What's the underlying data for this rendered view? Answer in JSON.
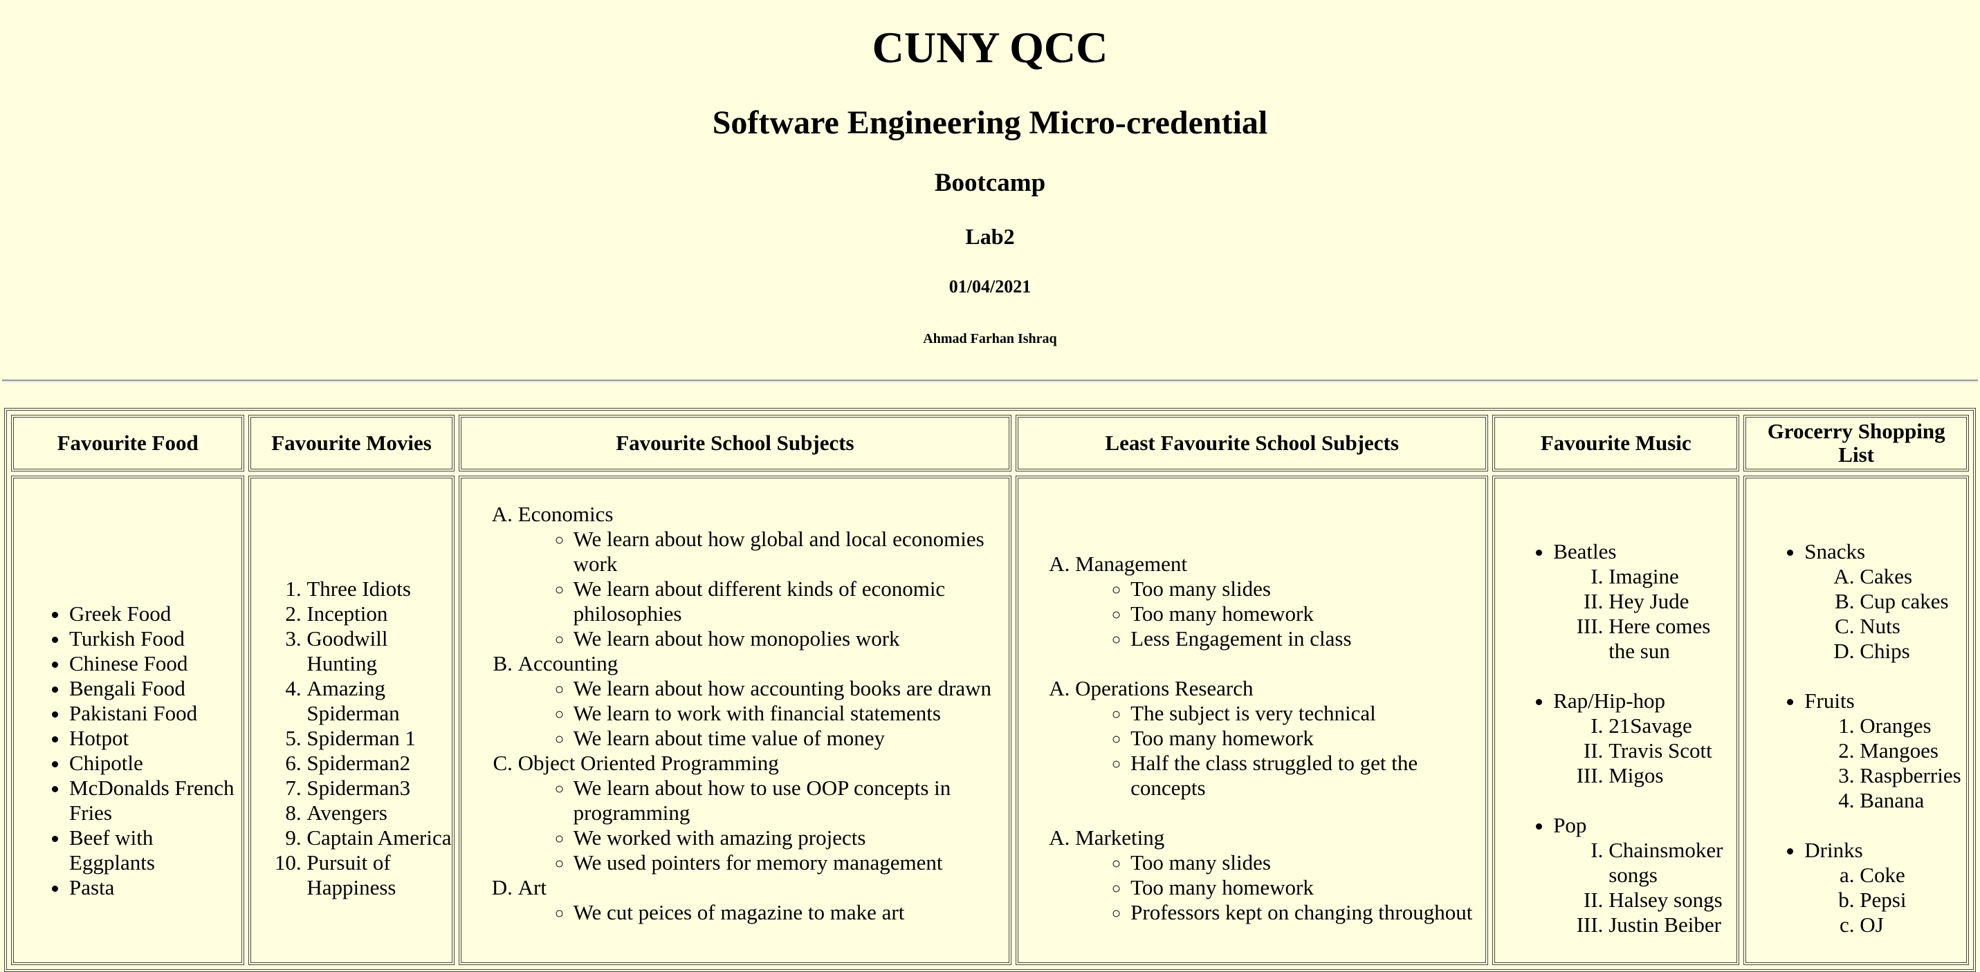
{
  "header": {
    "title": "CUNY QCC",
    "subtitle": "Software Engineering Micro-credential",
    "program": "Bootcamp",
    "lab": "Lab2",
    "date": "01/04/2021",
    "author": "Ahmad Farhan Ishraq"
  },
  "table": {
    "headers": {
      "food": "Favourite Food",
      "movies": "Favourite Movies",
      "favourite_subjects": "Favourite School Subjects",
      "least_subjects": "Least Favourite School Subjects",
      "music": "Favourite Music",
      "grocery": "Grocerry Shopping List"
    },
    "food": [
      "Greek Food",
      "Turkish Food",
      "Chinese Food",
      "Bengali Food",
      "Pakistani Food",
      "Hotpot",
      "Chipotle",
      "McDonalds French Fries",
      "Beef with Eggplants",
      "Pasta"
    ],
    "movies": [
      "Three Idiots",
      "Inception",
      "Goodwill Hunting",
      "Amazing Spiderman",
      "Spiderman 1",
      "Spiderman2",
      "Spiderman3",
      "Avengers",
      "Captain America",
      "Pursuit of Happiness"
    ],
    "favourite_subjects": [
      {
        "name": "Economics",
        "points": [
          "We learn about how global and local economies work",
          "We learn about different kinds of economic philosophies",
          "We learn about how monopolies work"
        ]
      },
      {
        "name": "Accounting",
        "points": [
          "We learn about how accounting books are drawn",
          "We learn to work with financial statements",
          "We learn about time value of money"
        ]
      },
      {
        "name": "Object Oriented Programming",
        "points": [
          "We learn about how to use OOP concepts in programming",
          "We worked with amazing projects",
          "We used pointers for memory management"
        ]
      },
      {
        "name": "Art",
        "points": [
          "We cut peices of magazine to make art"
        ]
      }
    ],
    "least_subjects": [
      {
        "name": "Management",
        "points": [
          "Too many slides",
          "Too many homework",
          "Less Engagement in class"
        ]
      },
      {
        "name": "Operations Research",
        "points": [
          "The subject is very technical",
          "Too many homework",
          "Half the class struggled to get the concepts"
        ]
      },
      {
        "name": "Marketing",
        "points": [
          "Too many slides",
          "Too many homework",
          "Professors kept on changing throughout"
        ]
      }
    ],
    "music": [
      {
        "genre": "Beatles",
        "songs": [
          "Imagine",
          "Hey Jude",
          "Here comes the sun"
        ]
      },
      {
        "genre": "Rap/Hip-hop",
        "songs": [
          "21Savage",
          "Travis Scott",
          "Migos"
        ]
      },
      {
        "genre": "Pop",
        "songs": [
          "Chainsmoker songs",
          "Halsey songs",
          "Justin Beiber"
        ]
      }
    ],
    "grocery": [
      {
        "category": "Snacks",
        "items": [
          "Cakes",
          "Cup cakes",
          "Nuts",
          "Chips"
        ]
      },
      {
        "category": "Fruits",
        "items": [
          "Oranges",
          "Mangoes",
          "Raspberries",
          "Banana"
        ]
      },
      {
        "category": "Drinks",
        "items": [
          "Coke",
          "Pepsi",
          "OJ"
        ]
      }
    ]
  }
}
